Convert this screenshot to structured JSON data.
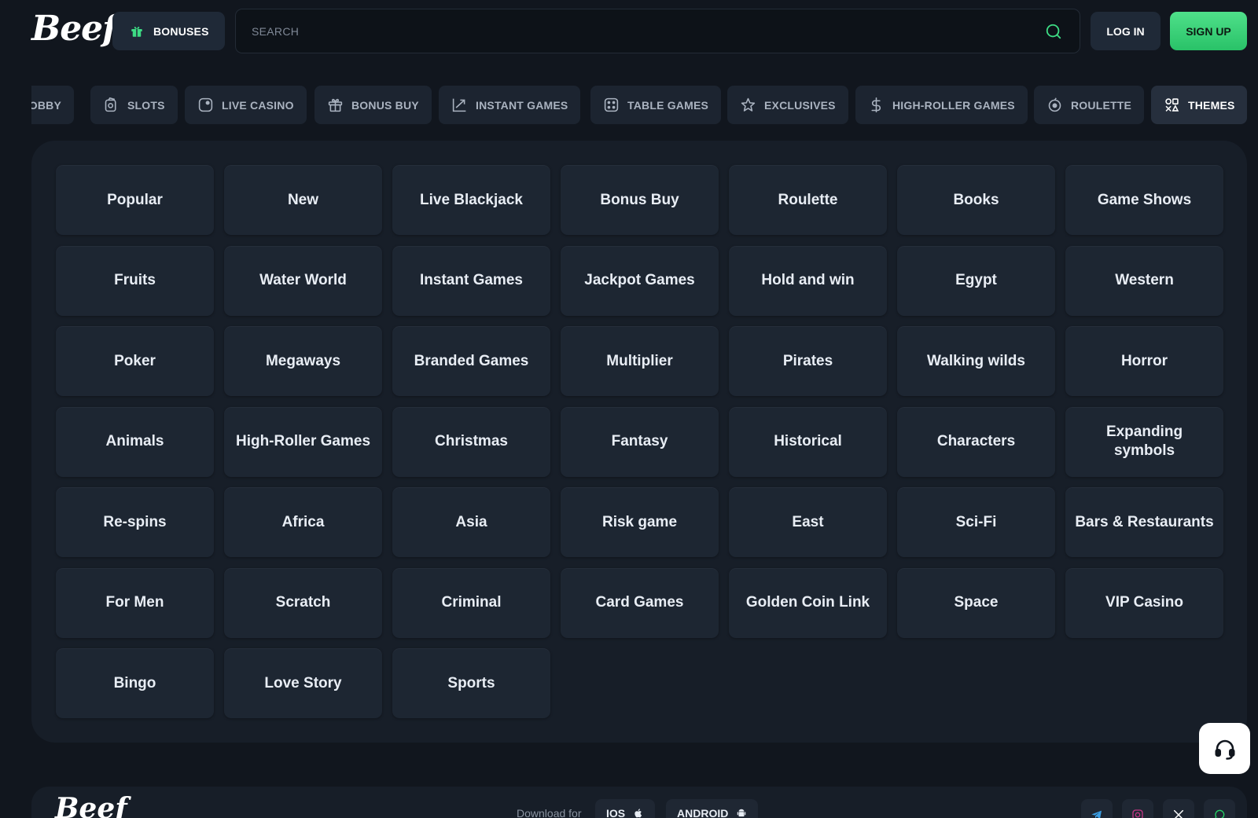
{
  "header": {
    "logo_text": "Beef",
    "bonuses_label": "BONUSES",
    "search_placeholder": "SEARCH",
    "login_label": "LOG IN",
    "signup_label": "SIGN UP"
  },
  "categories": [
    {
      "label": "LOBBY",
      "icon": "lobby-icon"
    },
    {
      "label": "SLOTS",
      "icon": "slots-icon"
    },
    {
      "label": "LIVE CASINO",
      "icon": "live-casino-icon"
    },
    {
      "label": "BONUS BUY",
      "icon": "gift-icon"
    },
    {
      "label": "INSTANT GAMES",
      "icon": "chart-up-icon"
    },
    {
      "label": "TABLE GAMES",
      "icon": "dice-icon"
    },
    {
      "label": "EXCLUSIVES",
      "icon": "star-icon"
    },
    {
      "label": "HIGH-ROLLER GAMES",
      "icon": "dollar-icon"
    },
    {
      "label": "ROULETTE",
      "icon": "roulette-icon"
    },
    {
      "label": "THEMES",
      "icon": "themes-icon",
      "active": true
    }
  ],
  "themes": [
    "Popular",
    "New",
    "Live Blackjack",
    "Bonus Buy",
    "Roulette",
    "Books",
    "Game Shows",
    "Fruits",
    "Water World",
    "Instant Games",
    "Jackpot Games",
    "Hold and win",
    "Egypt",
    "Western",
    "Poker",
    "Megaways",
    "Branded Games",
    "Multiplier",
    "Pirates",
    "Walking wilds",
    "Horror",
    "Animals",
    "High-Roller Games",
    "Christmas",
    "Fantasy",
    "Historical",
    "Characters",
    "Expanding symbols",
    "Re-spins",
    "Africa",
    "Asia",
    "Risk game",
    "East",
    "Sci-Fi",
    "Bars & Restaurants",
    "For Men",
    "Scratch",
    "Criminal",
    "Card Games",
    "Golden Coin Link",
    "Space",
    "VIP Casino",
    "Bingo",
    "Love Story",
    "Sports"
  ],
  "footer": {
    "logo_text": "Beef",
    "download_label": "Download for",
    "ios_label": "IOS",
    "android_label": "ANDROID",
    "socials": [
      "telegram-icon",
      "instagram-icon",
      "x-icon",
      "whatsapp-icon"
    ]
  },
  "colors": {
    "background": "#11161e",
    "panel": "#171e28",
    "tile": "#1d2632",
    "accent_green": "#29c268"
  }
}
